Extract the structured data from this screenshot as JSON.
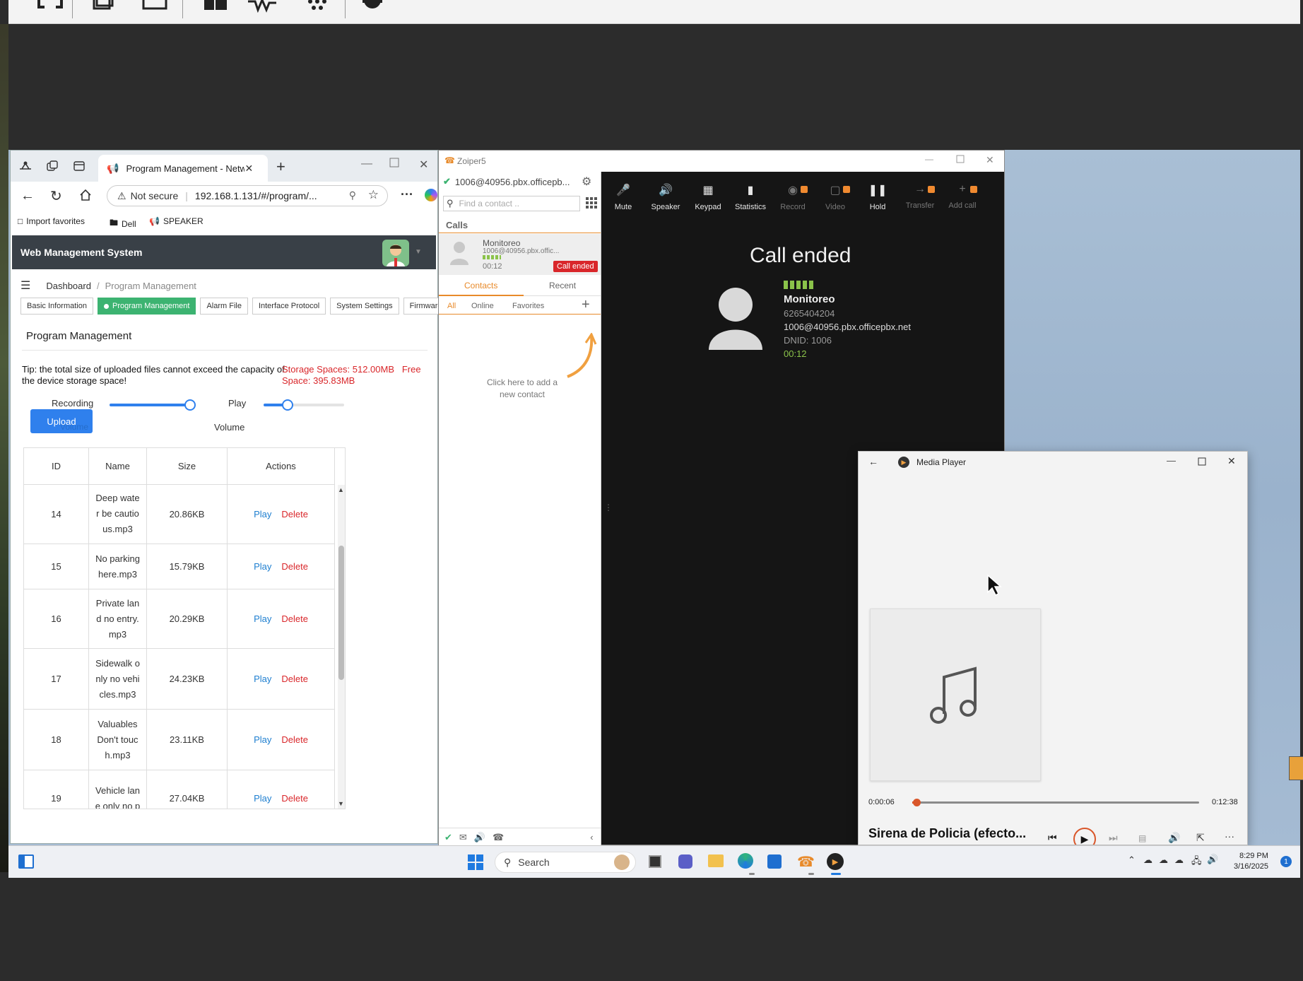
{
  "browser": {
    "tab_title": "Program Management - Network",
    "security_label": "Not secure",
    "url": "192.168.1.131/#/program/...",
    "favorites": [
      "Import favorites",
      "Dell",
      "SPEAKER"
    ]
  },
  "wms": {
    "app_title": "Web Management System",
    "breadcrumb": {
      "root": "Dashboard",
      "sep": "/",
      "current": "Program Management"
    },
    "tabs": [
      "Basic Information",
      "Program Management",
      "Alarm File",
      "Interface Protocol",
      "System Settings",
      "Firmware Up"
    ],
    "section_title": "Program Management",
    "tip": "Tip: the total size of uploaded files cannot exceed the capacity of the device storage space!",
    "storage": "Storage Spaces: 512.00MB",
    "free_label": "Free",
    "free_space": "Space: 395.83MB",
    "recording_label": "Recording",
    "play_label": "Play",
    "volume_label": "Volume",
    "upload_label": "Upload",
    "upload_overlap": "Volume",
    "recording_level": 0.95,
    "play_level": 0.3,
    "table": {
      "headers": [
        "ID",
        "Name",
        "Size",
        "Actions"
      ],
      "rows": [
        {
          "id": "14",
          "name": "Deep wate r be cautio us.mp3",
          "size": "20.86KB"
        },
        {
          "id": "15",
          "name": "No parking here.mp3",
          "size": "15.79KB"
        },
        {
          "id": "16",
          "name": "Private lan d no entry. mp3",
          "size": "20.29KB"
        },
        {
          "id": "17",
          "name": "Sidewalk o nly no vehi cles.mp3",
          "size": "24.23KB"
        },
        {
          "id": "18",
          "name": "Valuables Don't touc h.mp3",
          "size": "23.11KB"
        },
        {
          "id": "19",
          "name": "Vehicle lan e only no p",
          "size": "27.04KB"
        }
      ],
      "play_label": "Play",
      "delete_label": "Delete"
    }
  },
  "zoiper": {
    "window_title": "Zoiper5",
    "account": "1006@40956.pbx.officepb...",
    "search_placeholder": "Find a contact ..",
    "calls_label": "Calls",
    "call_item": {
      "name": "Monitoreo",
      "address": "1006@40956.pbx.offic...",
      "duration": "00:12",
      "status": "Call ended"
    },
    "tabs": [
      "Contacts",
      "Recent"
    ],
    "filters": [
      "All",
      "Online",
      "Favorites"
    ],
    "add_contact_hint": "Click here to add a new contact",
    "toolbar": [
      "Mute",
      "Speaker",
      "Keypad",
      "Statistics",
      "Record",
      "Video",
      "Hold",
      "Transfer",
      "Add call"
    ],
    "call_status": "Call ended",
    "contact_name": "Monitoreo",
    "contact_number": "6265404204",
    "contact_uri": "1006@40956.pbx.officepbx.net",
    "dnid": "DNID: 1006",
    "elapsed": "00:12"
  },
  "media_player": {
    "title": "Media Player",
    "position": "0:00:06",
    "duration": "0:12:38",
    "track": "Sirena de Policia (efecto...",
    "progress": 0.008
  },
  "taskbar": {
    "search_placeholder": "Search",
    "time": "8:29 PM",
    "date": "3/16/2025",
    "notification_count": "1"
  },
  "colors": {
    "accent_green": "#3cb371",
    "upload_blue": "#2f80ed",
    "danger_red": "#d9262a",
    "zoiper_orange": "#f08a30",
    "signal_green": "#8bc34a"
  }
}
